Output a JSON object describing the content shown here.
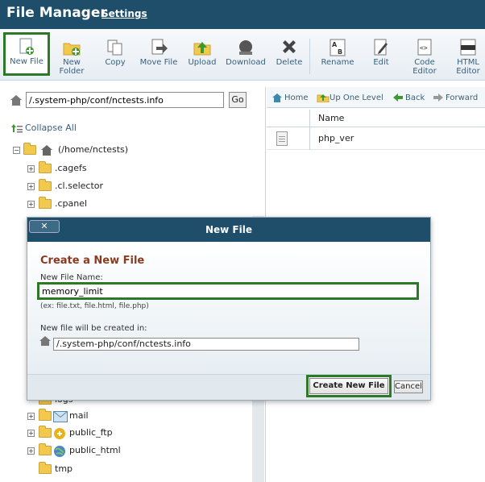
{
  "header": {
    "title": "File Manager",
    "settings": "Settings"
  },
  "toolbar": {
    "new_file": "New File",
    "new_folder_1": "New",
    "new_folder_2": "Folder",
    "copy": "Copy",
    "move_file": "Move File",
    "upload": "Upload",
    "download": "Download",
    "delete": "Delete",
    "rename": "Rename",
    "edit": "Edit",
    "code_editor_1": "Code",
    "code_editor_2": "Editor",
    "html_editor_1": "HTML",
    "html_editor_2": "Editor"
  },
  "left": {
    "path_value": "/.system-php/conf/nctests.info",
    "go": "Go",
    "collapse_all": "Collapse All",
    "root": "(/home/nctests)",
    "items": [
      ".cagefs",
      ".cl.selector",
      ".cpanel",
      "logs",
      "mail",
      "public_ftp",
      "public_html",
      "tmp"
    ]
  },
  "right": {
    "nav": {
      "home": "Home",
      "up": "Up One Level",
      "back": "Back",
      "forward": "Forward"
    },
    "column_name": "Name",
    "files": [
      "php_ver"
    ]
  },
  "modal": {
    "title": "New File",
    "close": "✕",
    "heading": "Create a New File",
    "name_label": "New File Name:",
    "name_value": "memory_limit",
    "example": "(ex: file.txt, file.html, file.php)",
    "dest_label": "New file will be created in:",
    "dest_value": "/.system-php/conf/nctests.info",
    "create": "Create New File",
    "cancel": "Cancel"
  },
  "colors": {
    "header": "#1e4e6a",
    "highlight": "#2c7a26",
    "heading": "#8a3a1e"
  }
}
